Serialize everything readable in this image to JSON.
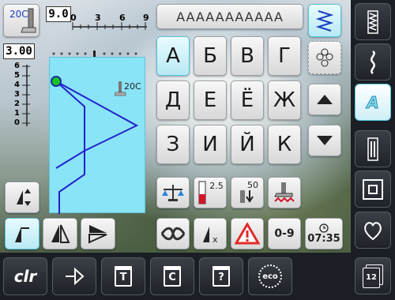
{
  "top": {
    "foot_label": "20C",
    "width_value": "9.0",
    "width_ticks": [
      "0",
      "3",
      "6",
      "9"
    ],
    "length_value": "3.00",
    "length_ticks": [
      "6",
      "5",
      "4",
      "3",
      "2",
      "1",
      "0"
    ]
  },
  "preview": {
    "foot_label": "20C"
  },
  "header_stitch": "AAAAAAAAAAA",
  "letters": [
    "А",
    "Б",
    "В",
    "Г",
    "Д",
    "Е",
    "Ё",
    "Ж",
    "З",
    "И",
    "Й",
    "К"
  ],
  "tension": {
    "value": "2.5"
  },
  "presser": {
    "value": "50"
  },
  "digits": {
    "label": "0-9"
  },
  "clock": {
    "time": "07:35"
  },
  "bottom_bar": {
    "clr_label": "clr",
    "eco_label": "eco",
    "memory_labels": [
      "T",
      "C",
      "?"
    ]
  },
  "sidebar": {
    "mode_a_label": "A",
    "pages_badge": "12"
  },
  "colors": {
    "accent": "#52c2dc",
    "stitch_line": "#2222cc",
    "warning": "#e32a2a",
    "tension_red": "#d4142a"
  }
}
